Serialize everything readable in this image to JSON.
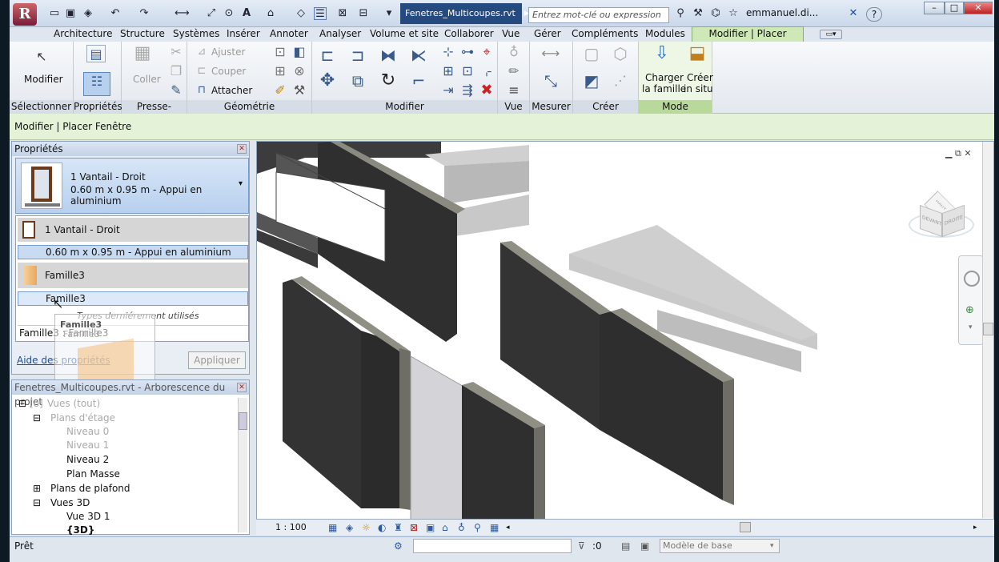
{
  "app": {
    "doc_title": "Fenetres_Multicoupes.rvt",
    "search_placeholder": "Entrez mot-clé ou expression",
    "username": "emmanuel.di...",
    "help": "?"
  },
  "menu": {
    "items": [
      "Architecture",
      "Structure",
      "Systèmes",
      "Insérer",
      "Annoter",
      "Analyser",
      "Volume et site",
      "Collaborer",
      "Vue",
      "Gérer",
      "Compléments",
      "Modules"
    ],
    "active": "Modifier | Placer Fenêtre"
  },
  "ribbon": {
    "panels": {
      "select": "Sélectionner",
      "properties": "Propriétés",
      "clipboard": "Presse-papiers",
      "geometry": "Géométrie",
      "modify": "Modifier",
      "view": "Vue",
      "measure": "Mesurer",
      "create": "Créer",
      "mode": "Mode"
    },
    "modify_label": "Modifier",
    "paste_label": "Coller",
    "ajuster": "Ajuster",
    "couper": "Couper",
    "attacher": "Attacher",
    "charger_line1": "Charger",
    "charger_line2": "la famille",
    "creer_line1": "Créer",
    "creer_line2": "in situ"
  },
  "options_bar": "Modifier | Placer Fenêtre",
  "properties": {
    "title": "Propriétés",
    "type_name": "1 Vantail - Droit",
    "type_desc": "0.60 m x 0.95 m - Appui en aluminium",
    "dropdown": {
      "family1": "1 Vantail - Droit",
      "type1": "0.60 m x 0.95 m - Appui en aluminium",
      "family2": "Famille3",
      "type2": "Famille3",
      "recent": "Types derniérement utilisés",
      "recent_item": "Famille3 : Famille3"
    },
    "drag_label": "Famille3",
    "drag_sub": "Famille3",
    "help_link": "Aide des propriétés",
    "apply_button": "Appliquer"
  },
  "browser": {
    "title": "Fenetres_Multicoupes.rvt - Arborescence du projet",
    "items": {
      "views": "Vues (tout)",
      "floor_plans": "Plans d'étage",
      "level0": "Niveau 0",
      "level1": "Niveau 1",
      "level2": "Niveau 2",
      "site": "Plan Masse",
      "ceiling": "Plans de plafond",
      "views3d": "Vues 3D",
      "view3d1": "Vue 3D 1",
      "view3d": "{3D}"
    }
  },
  "viewcube": {
    "face_front": "DEVANT",
    "face_right": "DROITE",
    "face_top": "HAUT"
  },
  "view_control": {
    "scale": "1 : 100"
  },
  "status": {
    "text": "Prêt",
    "filter": ":0",
    "model": "Modèle de base"
  },
  "colors": {
    "title_active": "#244a80",
    "contextual_tab": "#cfe8b7",
    "options_bar": "#e4f2d7",
    "selection_blue": "#b8d0ee"
  }
}
